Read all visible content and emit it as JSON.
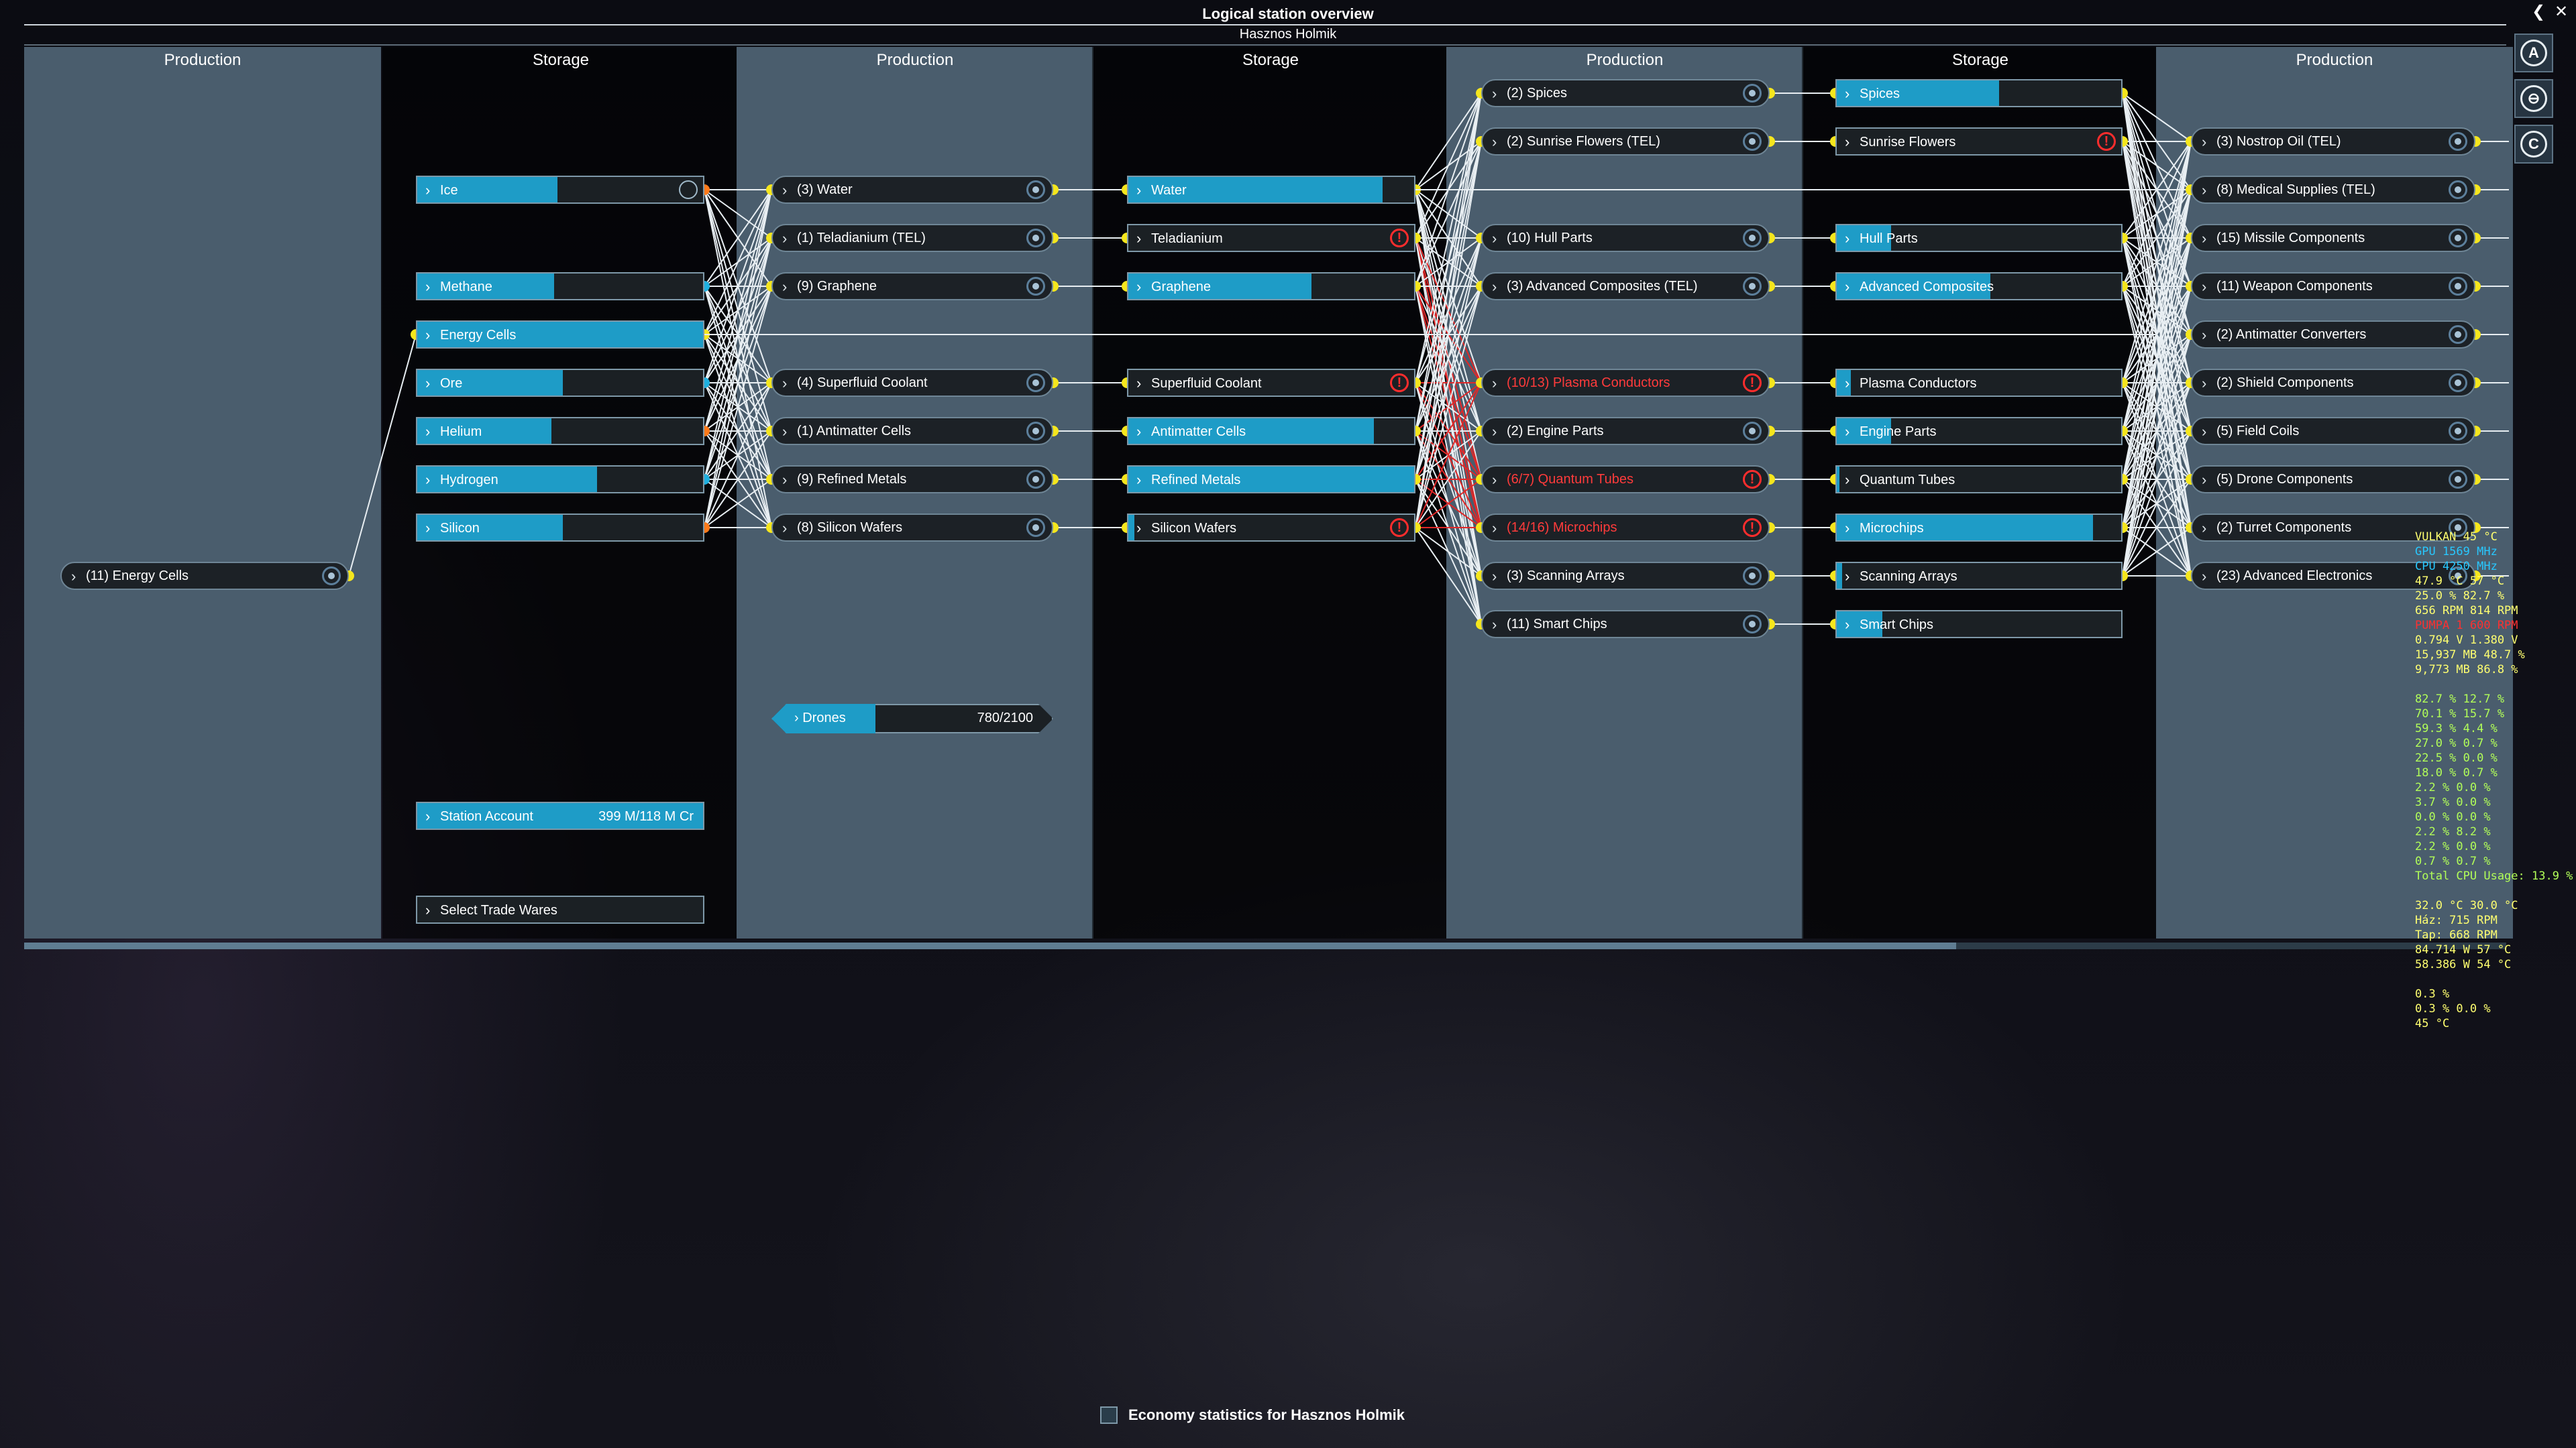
{
  "window": {
    "title": "Logical station overview",
    "station": "Hasznos Holmik",
    "back_glyph": "❮",
    "close_glyph": "✕"
  },
  "column_headers": [
    "Production",
    "Storage",
    "Production",
    "Storage",
    "Production",
    "Storage",
    "Production"
  ],
  "col1": [
    {
      "label": "(11) Energy Cells",
      "status": "ok"
    }
  ],
  "col2": [
    {
      "label": "Ice",
      "fill": 0.49,
      "icon": "swap"
    },
    {
      "label": "Methane",
      "fill": 0.48
    },
    {
      "label": "Energy Cells",
      "fill": 1.0
    },
    {
      "label": "Ore",
      "fill": 0.51
    },
    {
      "label": "Helium",
      "fill": 0.47
    },
    {
      "label": "Hydrogen",
      "fill": 0.63
    },
    {
      "label": "Silicon",
      "fill": 0.51
    }
  ],
  "col2_extra": {
    "account_label": "Station Account",
    "account_value": "399 M/118 M Cr",
    "trade_label": "Select Trade Wares"
  },
  "col3": [
    {
      "label": "(3) Water",
      "status": "ok"
    },
    {
      "label": "(1) Teladianium (TEL)",
      "status": "ok"
    },
    {
      "label": "(9) Graphene",
      "status": "ok"
    },
    {
      "label": "(4) Superfluid Coolant",
      "status": "ok"
    },
    {
      "label": "(1) Antimatter Cells",
      "status": "ok"
    },
    {
      "label": "(9) Refined Metals",
      "status": "ok"
    },
    {
      "label": "(8) Silicon Wafers",
      "status": "ok"
    }
  ],
  "drones": {
    "label": "Drones",
    "value": "780/2100",
    "fill": 0.37
  },
  "col4": [
    {
      "label": "Water",
      "fill": 0.89
    },
    {
      "label": "Teladianium",
      "fill": 0.0,
      "warn": true
    },
    {
      "label": "Graphene",
      "fill": 0.64
    },
    {
      "label": "Superfluid Coolant",
      "fill": 0.0,
      "warn": true
    },
    {
      "label": "Antimatter Cells",
      "fill": 0.86
    },
    {
      "label": "Refined Metals",
      "fill": 1.0
    },
    {
      "label": "Silicon Wafers",
      "fill": 0.02,
      "warn": true
    }
  ],
  "col5": [
    {
      "label": "(2) Spices",
      "status": "ok"
    },
    {
      "label": "(2) Sunrise Flowers (TEL)",
      "status": "ok"
    },
    {
      "label": "(10) Hull Parts",
      "status": "ok"
    },
    {
      "label": "(3) Advanced Composites (TEL)",
      "status": "ok"
    },
    {
      "label": "(10/13) Plasma Conductors",
      "status": "alert"
    },
    {
      "label": "(2) Engine Parts",
      "status": "ok"
    },
    {
      "label": "(6/7) Quantum Tubes",
      "status": "alert"
    },
    {
      "label": "(14/16) Microchips",
      "status": "alert"
    },
    {
      "label": "(3) Scanning Arrays",
      "status": "ok"
    },
    {
      "label": "(11) Smart Chips",
      "status": "ok"
    }
  ],
  "col6": [
    {
      "label": "Spices",
      "fill": 0.57
    },
    {
      "label": "Sunrise Flowers",
      "fill": 0.0,
      "warn": true
    },
    {
      "label": "Hull Parts",
      "fill": 0.19
    },
    {
      "label": "Advanced Composites",
      "fill": 0.54
    },
    {
      "label": "Plasma Conductors",
      "fill": 0.05
    },
    {
      "label": "Engine Parts",
      "fill": 0.19
    },
    {
      "label": "Quantum Tubes",
      "fill": 0.01
    },
    {
      "label": "Microchips",
      "fill": 0.9
    },
    {
      "label": "Scanning Arrays",
      "fill": 0.02
    },
    {
      "label": "Smart Chips",
      "fill": 0.16
    }
  ],
  "col7": [
    {
      "label": "(3) Nostrop Oil (TEL)",
      "status": "ok"
    },
    {
      "label": "(8) Medical Supplies (TEL)",
      "status": "ok"
    },
    {
      "label": "(15) Missile Components",
      "status": "ok"
    },
    {
      "label": "(11) Weapon Components",
      "status": "ok"
    },
    {
      "label": "(2) Antimatter Converters",
      "status": "ok"
    },
    {
      "label": "(2) Shield Components",
      "status": "ok"
    },
    {
      "label": "(5) Field Coils",
      "status": "ok"
    },
    {
      "label": "(5) Drone Components",
      "status": "ok"
    },
    {
      "label": "(2) Turret Components",
      "status": "ok"
    },
    {
      "label": "(23) Advanced Electronics",
      "status": "ok"
    }
  ],
  "side_buttons": [
    {
      "name": "autopilot-button",
      "glyph": "A"
    },
    {
      "name": "map-button",
      "glyph": "⊖"
    },
    {
      "name": "crew-button",
      "glyph": "C"
    }
  ],
  "osd": [
    {
      "t": "VULKAN  45 °C",
      "c": "y"
    },
    {
      "t": "GPU     1569 MHz",
      "c": "c"
    },
    {
      "t": "CPU     4250 MHz",
      "c": "c"
    },
    {
      "t": "47.9 °C 57 °C",
      "c": "y"
    },
    {
      "t": "25.0 % 82.7 %",
      "c": "y"
    },
    {
      "t": "656 RPM 814 RPM",
      "c": "y"
    },
    {
      "t": "PUMPA 1 600 RPM",
      "c": "r"
    },
    {
      "t": "0.794 V 1.380 V",
      "c": "y"
    },
    {
      "t": "15,937 MB 48.7 %",
      "c": "y"
    },
    {
      "t": "9,773 MB 86.8 %",
      "c": "y"
    },
    {
      "t": "",
      "c": "y"
    },
    {
      "t": "82.7 % 12.7 %",
      "c": "g"
    },
    {
      "t": "70.1 % 15.7 %",
      "c": "g"
    },
    {
      "t": "59.3 % 4.4 %",
      "c": "g"
    },
    {
      "t": "27.0 % 0.7 %",
      "c": "g"
    },
    {
      "t": "22.5 % 0.0 %",
      "c": "g"
    },
    {
      "t": "18.0 % 0.7 %",
      "c": "g"
    },
    {
      "t": "2.2 % 0.0 %",
      "c": "g"
    },
    {
      "t": "3.7 % 0.0 %",
      "c": "g"
    },
    {
      "t": "0.0 % 0.0 %",
      "c": "g"
    },
    {
      "t": "2.2 % 8.2 %",
      "c": "g"
    },
    {
      "t": "2.2 % 0.0 %",
      "c": "g"
    },
    {
      "t": "0.7 % 0.7 %",
      "c": "g"
    },
    {
      "t": "Total CPU Usage: 13.9 %",
      "c": "g"
    },
    {
      "t": "",
      "c": "g"
    },
    {
      "t": "32.0 °C 30.0 °C",
      "c": "y"
    },
    {
      "t": "Ház: 715 RPM",
      "c": "y"
    },
    {
      "t": "Tap: 668 RPM",
      "c": "y"
    },
    {
      "t": "84.714 W 57 °C",
      "c": "y"
    },
    {
      "t": "58.386 W 54 °C",
      "c": "y"
    },
    {
      "t": "",
      "c": "y"
    },
    {
      "t": "0.3 %",
      "c": "y"
    },
    {
      "t": "0.3 % 0.0 %",
      "c": "y"
    },
    {
      "t": "45 °C",
      "c": "y"
    }
  ],
  "economy_label": "Economy statistics for Hasznos Holmik"
}
